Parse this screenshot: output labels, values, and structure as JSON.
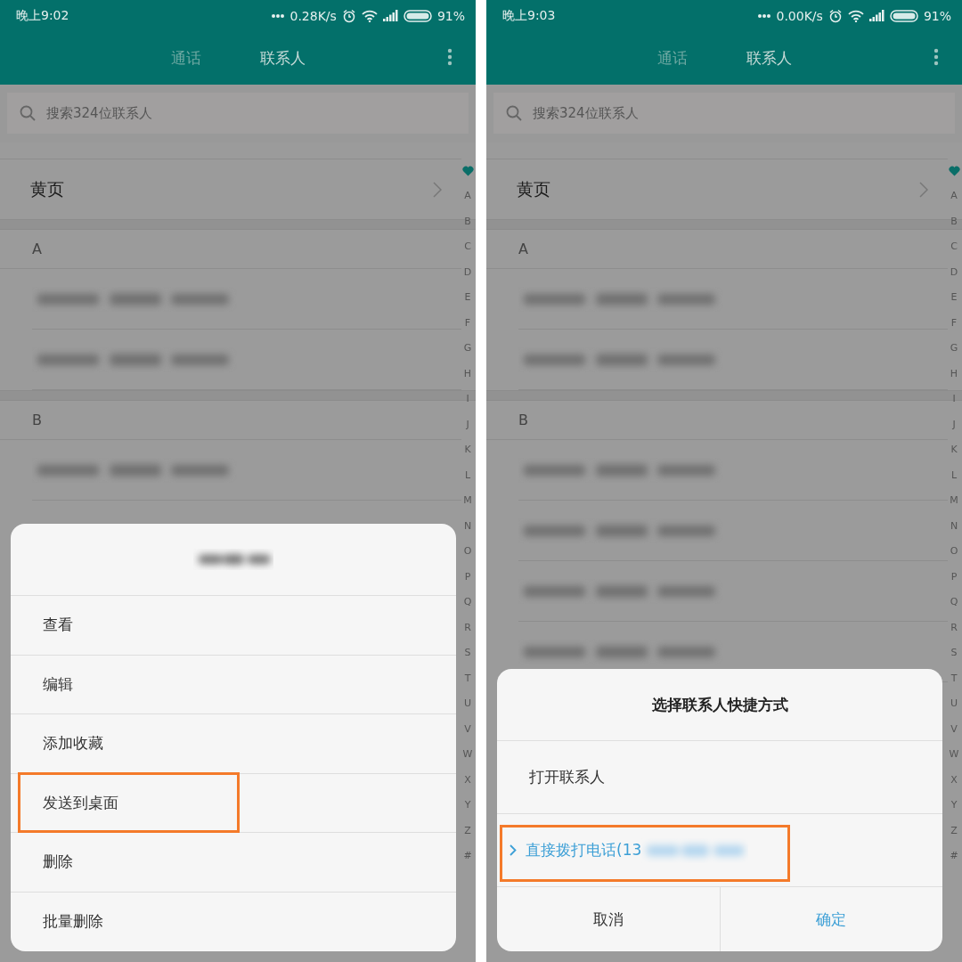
{
  "panels": [
    {
      "status_bar": {
        "time": "晚上9:02",
        "speed": "0.28K/s",
        "battery": "91%"
      },
      "tabs": [
        {
          "label": "通话",
          "selected": false
        },
        {
          "label": "联系人",
          "selected": true
        }
      ],
      "search": {
        "placeholder": "搜索324位联系人"
      },
      "sections": [
        {
          "rows": [
            {
              "kind": "link",
              "label": "黄页"
            }
          ]
        },
        {
          "header": "A",
          "rows": [
            {
              "kind": "blurred"
            },
            {
              "kind": "blurred"
            }
          ]
        },
        {
          "header": "B",
          "rows": [
            {
              "kind": "blurred"
            }
          ]
        }
      ],
      "index": [
        "A",
        "B",
        "C",
        "D",
        "E",
        "F",
        "G",
        "H",
        "I",
        "J",
        "K",
        "L",
        "M",
        "N",
        "O",
        "P",
        "Q",
        "R",
        "S",
        "T",
        "U",
        "V",
        "W",
        "X",
        "Y",
        "Z",
        "#"
      ],
      "dialog": {
        "kind": "menu",
        "title_blurred": true,
        "items": [
          {
            "label": "查看",
            "highlighted": false
          },
          {
            "label": "编辑",
            "highlighted": false
          },
          {
            "label": "添加收藏",
            "highlighted": false
          },
          {
            "label": "发送到桌面",
            "highlighted": true
          },
          {
            "label": "删除",
            "highlighted": false
          },
          {
            "label": "批量删除",
            "highlighted": false
          }
        ]
      }
    },
    {
      "status_bar": {
        "time": "晚上9:03",
        "speed": "0.00K/s",
        "battery": "91%"
      },
      "tabs": [
        {
          "label": "通话",
          "selected": false
        },
        {
          "label": "联系人",
          "selected": true
        }
      ],
      "search": {
        "placeholder": "搜索324位联系人"
      },
      "sections": [
        {
          "rows": [
            {
              "kind": "link",
              "label": "黄页"
            }
          ]
        },
        {
          "header": "A",
          "rows": [
            {
              "kind": "blurred"
            },
            {
              "kind": "blurred"
            }
          ]
        },
        {
          "header": "B",
          "rows": [
            {
              "kind": "blurred"
            },
            {
              "kind": "blurred"
            },
            {
              "kind": "blurred"
            },
            {
              "kind": "blurred"
            }
          ]
        }
      ],
      "index": [
        "A",
        "B",
        "C",
        "D",
        "E",
        "F",
        "G",
        "H",
        "I",
        "J",
        "K",
        "L",
        "M",
        "N",
        "O",
        "P",
        "Q",
        "R",
        "S",
        "T",
        "U",
        "V",
        "W",
        "X",
        "Y",
        "Z",
        "#"
      ],
      "dialog": {
        "kind": "shortcut",
        "title": "选择联系人快捷方式",
        "options": [
          {
            "label": "打开联系人",
            "selected": false,
            "number_blurred": false,
            "highlighted": false
          },
          {
            "label": "直接拨打电话(13",
            "selected": true,
            "number_blurred": true,
            "highlighted": true
          }
        ],
        "buttons": [
          {
            "label": "取消",
            "kind": "cancel"
          },
          {
            "label": "确定",
            "kind": "confirm"
          }
        ]
      }
    }
  ]
}
